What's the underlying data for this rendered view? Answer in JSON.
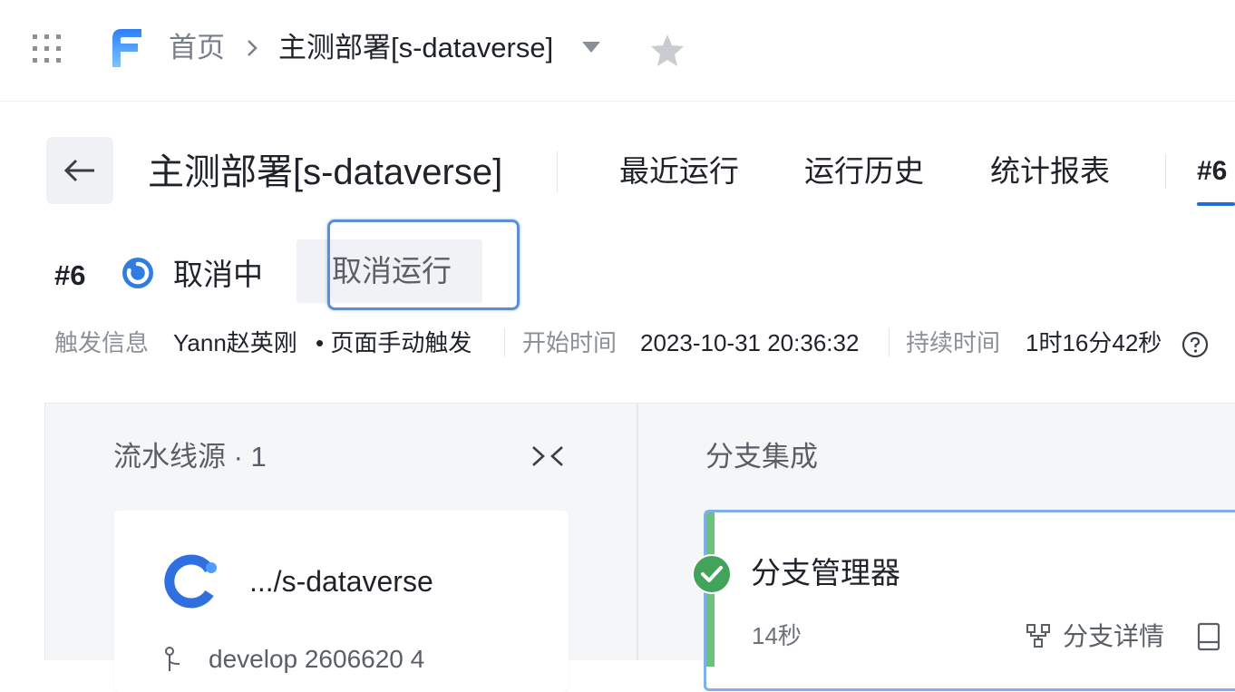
{
  "breadcrumb": {
    "home": "首页",
    "current": "主测部署[s-dataverse]"
  },
  "header": {
    "title": "主测部署[s-dataverse]",
    "tabs": [
      {
        "label": "最近运行"
      },
      {
        "label": "运行历史"
      },
      {
        "label": "统计报表"
      },
      {
        "label": "#6"
      }
    ]
  },
  "run": {
    "number": "#6",
    "status": "取消中",
    "cancel_button": "取消运行"
  },
  "meta": {
    "trigger_label": "触发信息",
    "trigger_user": "Yann赵英刚",
    "trigger_method": "• 页面手动触发",
    "start_label": "开始时间",
    "start_value": "2023-10-31 20:36:32",
    "duration_label": "持续时间",
    "duration_value": "1时16分42秒"
  },
  "stages": {
    "source": {
      "title": "流水线源 · 1",
      "repo_name": ".../s-dataverse",
      "branch_partial": "develop   2606620 4"
    },
    "branch": {
      "title": "分支集成",
      "job_name": "分支管理器",
      "job_duration": "14秒",
      "detail_link": "分支详情"
    }
  },
  "colors": {
    "accent_blue": "#1f6ed4",
    "success_green": "#43a35a",
    "highlight_blue": "#5a8fd8"
  },
  "icons": [
    "apps-grid-icon",
    "logo-icon",
    "chevron-right-icon",
    "caret-down-icon",
    "star-icon",
    "back-arrow-icon",
    "spinner-icon",
    "help-icon",
    "collapse-icon",
    "repo-logo-icon",
    "branch-icon",
    "success-check-icon",
    "branch-detail-icon",
    "log-icon"
  ]
}
